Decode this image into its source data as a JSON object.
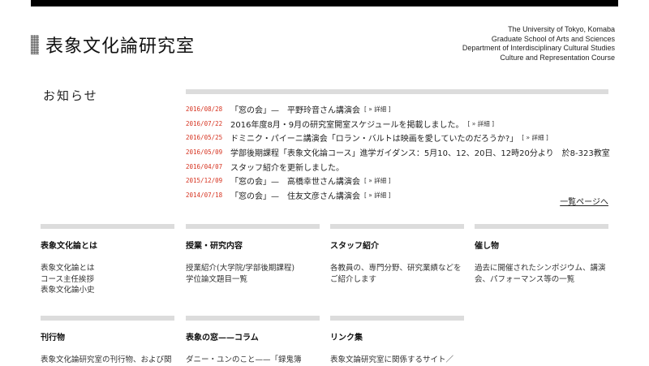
{
  "site": {
    "title": "表象文化論研究室",
    "university": [
      "The University of Tokyo, Komaba",
      "Graduate School of Arts and Sciences",
      "Department of Interdisciplinary Cultural Studies",
      "Culture and Representation Course"
    ]
  },
  "news": {
    "heading": "お知らせ",
    "items": [
      {
        "date": "2016/08/28",
        "text": "「窓の会」—　平野玲音さん講演会",
        "detail": "[ » 詳細 ]"
      },
      {
        "date": "2016/07/22",
        "text": "2016年度8月・9月の研究室開室スケジュールを掲載しました。",
        "detail": "[ » 詳細 ]"
      },
      {
        "date": "2016/05/25",
        "text": "ドミニク・パイーニ講演会「ロラン・バルトは映画を愛していたのだろうか?」",
        "detail": "[ » 詳細 ]"
      },
      {
        "date": "2016/05/09",
        "text": "学部後期課程「表象文化論コース」進学ガイダンス：5月10、12、20日、12時20分より　於8-323教室",
        "detail": ""
      },
      {
        "date": "2016/04/07",
        "text": "スタッフ紹介を更新しました。",
        "detail": ""
      },
      {
        "date": "2015/12/09",
        "text": "「窓の会」—　高橋幸世さん講演会",
        "detail": "[ » 詳細 ]"
      },
      {
        "date": "2014/07/18",
        "text": "「窓の会」—　住友文彦さん講演会",
        "detail": "[ » 詳細 ]"
      }
    ],
    "list_link": "一覧ページへ"
  },
  "sections": [
    {
      "title": "表象文化論とは",
      "lines": [
        "表象文化論とは",
        "コース主任挨拶",
        "表象文化論小史"
      ]
    },
    {
      "title": "授業・研究内容",
      "lines": [
        "授業紹介(大学院/学部後期課程)",
        "学位論文題目一覧"
      ]
    },
    {
      "title": "スタッフ紹介",
      "lines": [
        "各教員の、専門分野、研究業績などを",
        "ご紹介します"
      ]
    },
    {
      "title": "催し物",
      "lines": [
        "過去に開催されたシンポジウム、講演",
        "会、パフォーマンス等の一覧"
      ]
    },
    {
      "title": "刊行物",
      "lines": [
        "表象文化論研究室の刊行物、および関"
      ]
    },
    {
      "title": "表象の窓——コラム",
      "lines": [
        "ダニー・ユンのこと——「録鬼簿"
      ]
    },
    {
      "title": "リンク集",
      "lines": [
        "表象文論研究室に関係するサイト／"
      ]
    }
  ]
}
